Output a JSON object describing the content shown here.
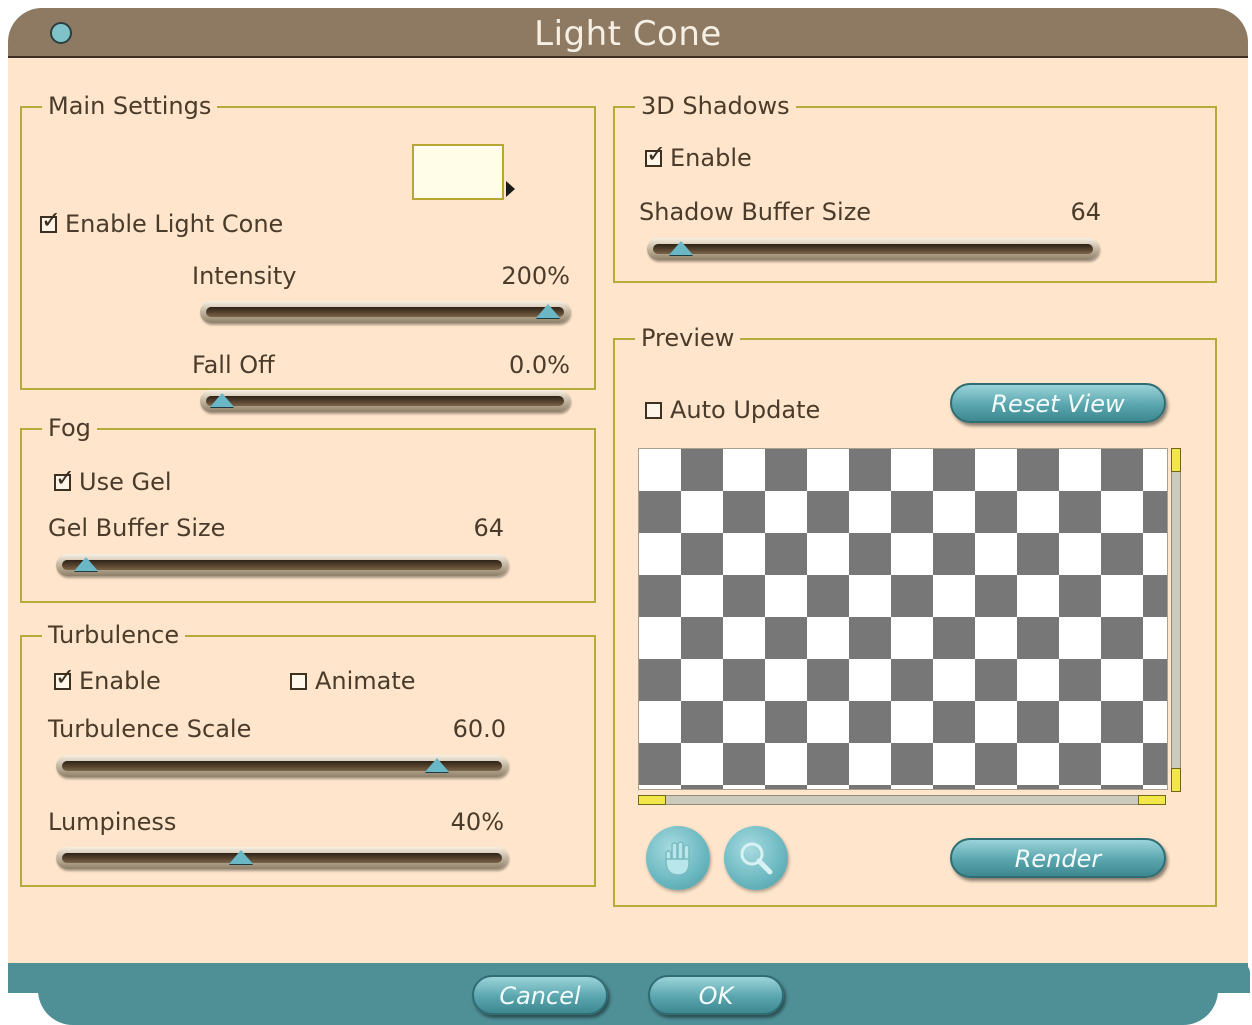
{
  "window": {
    "title": "Light Cone"
  },
  "main_settings": {
    "title": "Main Settings",
    "enable_light_cone": {
      "label": "Enable Light Cone",
      "checked": true
    },
    "color_swatch": "#fffde8",
    "intensity": {
      "label": "Intensity",
      "value": "200%",
      "fraction": 1.0
    },
    "fall_off": {
      "label": "Fall Off",
      "value": "0.0%",
      "fraction": 0.0
    }
  },
  "fog": {
    "title": "Fog",
    "use_gel": {
      "label": "Use Gel",
      "checked": true
    },
    "gel_buffer_size": {
      "label": "Gel Buffer Size",
      "value": "64",
      "fraction": 0.02
    }
  },
  "turbulence": {
    "title": "Turbulence",
    "enable": {
      "label": "Enable",
      "checked": true
    },
    "animate": {
      "label": "Animate",
      "checked": false
    },
    "turbulence_scale": {
      "label": "Turbulence Scale",
      "value": "60.0",
      "fraction": 0.88
    },
    "lumpiness": {
      "label": "Lumpiness",
      "value": "40%",
      "fraction": 0.4
    }
  },
  "shadows": {
    "title": "3D Shadows",
    "enable": {
      "label": "Enable",
      "checked": true
    },
    "shadow_buffer_size": {
      "label": "Shadow Buffer Size",
      "value": "64",
      "fraction": 0.03
    }
  },
  "preview": {
    "title": "Preview",
    "auto_update": {
      "label": "Auto Update",
      "checked": false
    },
    "reset_view": "Reset View",
    "render": "Render",
    "tools": [
      "hand-icon",
      "magnifier-icon"
    ]
  },
  "footer": {
    "cancel": "Cancel",
    "ok": "OK"
  },
  "colors": {
    "title_bar": "#8e7a63",
    "panel_bg": "#fee5cb",
    "group_border": "#b4ac3a",
    "accent_teal": "#5aa6ae",
    "footer_bar": "#4f8f96"
  }
}
